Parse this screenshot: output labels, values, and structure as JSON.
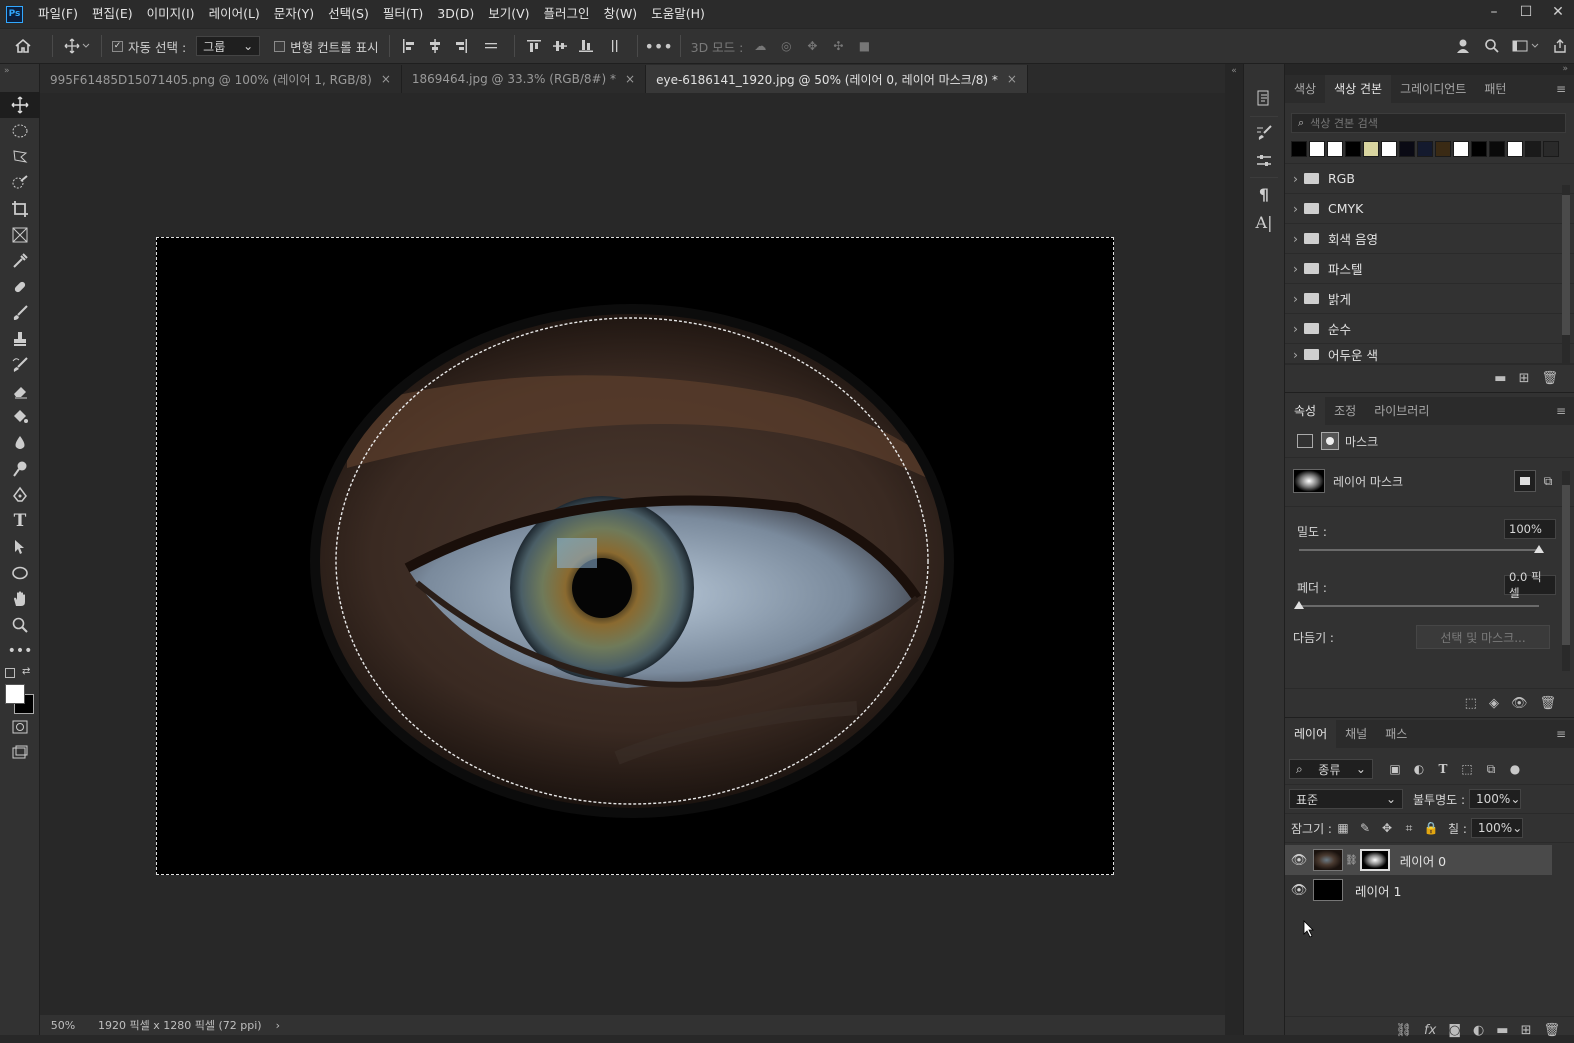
{
  "menu": {
    "items": [
      "파일(F)",
      "편집(E)",
      "이미지(I)",
      "레이어(L)",
      "문자(Y)",
      "선택(S)",
      "필터(T)",
      "3D(D)",
      "보기(V)",
      "플러그인",
      "창(W)",
      "도움말(H)"
    ],
    "logo": "Ps"
  },
  "options": {
    "auto_select_label": "자동 선택 :",
    "auto_select_value": "그룹",
    "show_transform_label": "변형 컨트롤 표시",
    "mode_3d_label": "3D 모드 :"
  },
  "tabs": [
    {
      "label": "995F61485D15071405.png @ 100% (레이어 1, RGB/8)",
      "close": "×"
    },
    {
      "label": "1869464.jpg @ 33.3% (RGB/8#) *",
      "close": "×"
    },
    {
      "label": "eye-6186141_1920.jpg @ 50% (레이어 0, 레이어 마스크/8) *",
      "close": "×"
    }
  ],
  "status": {
    "zoom": "50%",
    "doc_info": "1920 픽셀 x 1280 픽셀 (72 ppi)",
    "arrow": "›"
  },
  "swatches_panel": {
    "tabs": [
      "색상",
      "색상 견본",
      "그레이디언트",
      "패턴"
    ],
    "search_placeholder": "색상 견본 검색",
    "swatch_colors": [
      "#000000",
      "#ffffff",
      "#ffffff",
      "#000000",
      "#d9d5a0",
      "#ffffff",
      "#0a0a14",
      "#141a2e",
      "#3a2a14",
      "#ffffff",
      "#000000",
      "#0a0a0a",
      "#ffffff",
      "#1a1a1a",
      "#2a2a2a"
    ],
    "folders": [
      "RGB",
      "CMYK",
      "회색 음영",
      "파스텔",
      "밝게",
      "순수",
      "어두운 색"
    ]
  },
  "properties_panel": {
    "tabs": [
      "속성",
      "조정",
      "라이브러리"
    ],
    "mask_label": "마스크",
    "layer_mask_label": "레이어 마스크",
    "density_label": "밀도 :",
    "density_value": "100%",
    "density_level": 1.0,
    "feather_label": "페더 :",
    "feather_value": "0.0 픽셀",
    "feather_level": 0.0,
    "refine_label": "다듬기 :",
    "refine_button": "선택 및 마스크..."
  },
  "layers_panel": {
    "tabs": [
      "레이어",
      "채널",
      "패스"
    ],
    "filter_label": "종류",
    "blend_mode": "표준",
    "opacity_label": "불투명도 :",
    "opacity_value": "100%",
    "lock_label": "잠그기 :",
    "fill_label": "칠 :",
    "fill_value": "100%",
    "layers": [
      {
        "name": "레이어 0",
        "selected": true,
        "has_mask": true
      },
      {
        "name": "레이어 1",
        "selected": false,
        "has_mask": false
      }
    ]
  },
  "colors": {
    "accent": "#31a8ff",
    "canvas_bg": "#282828",
    "panel_bg": "#323232"
  }
}
